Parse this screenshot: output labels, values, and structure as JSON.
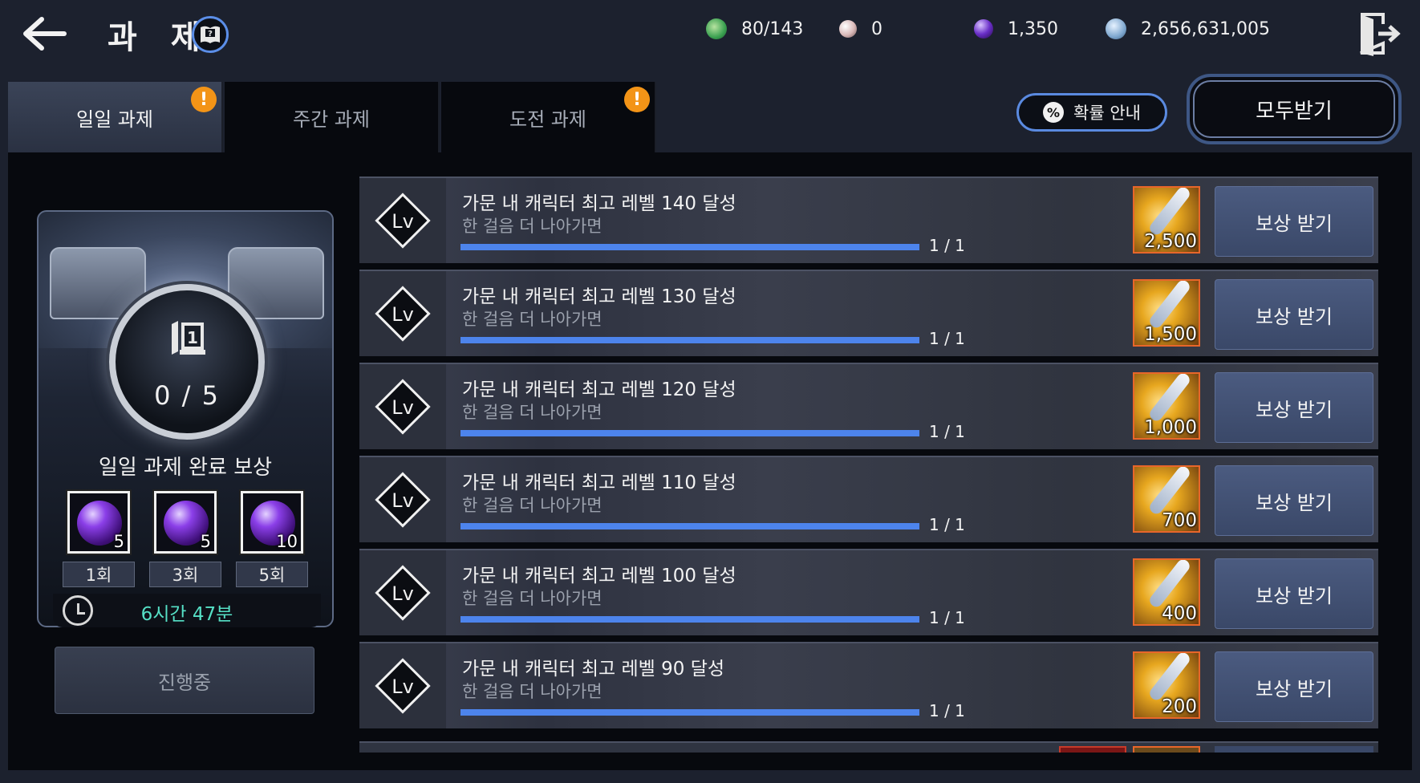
{
  "header": {
    "title": "과 제",
    "currencies": [
      {
        "icon": "stamina-icon",
        "value": "80/143",
        "color": "#3aa050"
      },
      {
        "icon": "pearl-icon",
        "value": "0",
        "color": "#d9b8b8"
      },
      {
        "icon": "purple-gem-icon",
        "value": "1,350",
        "color": "#6a2fc8"
      },
      {
        "icon": "silver-coin-icon",
        "value": "2,656,631,005",
        "color": "#7ea7cf"
      }
    ]
  },
  "tabs": [
    {
      "label": "일일 과제",
      "active": true,
      "alert": true
    },
    {
      "label": "주간 과제",
      "active": false,
      "alert": false
    },
    {
      "label": "도전 과제",
      "active": false,
      "alert": true
    }
  ],
  "alert_mark": "!",
  "probability_button": {
    "icon_text": "%",
    "label": "확률 안내"
  },
  "claim_all_label": "모두받기",
  "daily_card": {
    "medal_number": "1",
    "progress": "0 / 5",
    "title": "일일 과제 완료 보상",
    "rewards": [
      {
        "count": "5",
        "label": "1회"
      },
      {
        "count": "5",
        "label": "3회"
      },
      {
        "count": "10",
        "label": "5회"
      }
    ],
    "timer": "6시간 47분",
    "status_button": "진행중"
  },
  "quests": [
    {
      "title": "가문 내 캐릭터 최고 레벨 140 달성",
      "subtitle": "한 걸음 더 나아가면",
      "progress": "1 / 1",
      "progress_fraction": 1.0,
      "reward_amount": "2,500",
      "claim_label": "보상 받기"
    },
    {
      "title": "가문 내 캐릭터 최고 레벨 130 달성",
      "subtitle": "한 걸음 더 나아가면",
      "progress": "1 / 1",
      "progress_fraction": 1.0,
      "reward_amount": "1,500",
      "claim_label": "보상 받기"
    },
    {
      "title": "가문 내 캐릭터 최고 레벨 120 달성",
      "subtitle": "한 걸음 더 나아가면",
      "progress": "1 / 1",
      "progress_fraction": 1.0,
      "reward_amount": "1,000",
      "claim_label": "보상 받기"
    },
    {
      "title": "가문 내 캐릭터 최고 레벨 110 달성",
      "subtitle": "한 걸음 더 나아가면",
      "progress": "1 / 1",
      "progress_fraction": 1.0,
      "reward_amount": "700",
      "claim_label": "보상 받기"
    },
    {
      "title": "가문 내 캐릭터 최고 레벨 100 달성",
      "subtitle": "한 걸음 더 나아가면",
      "progress": "1 / 1",
      "progress_fraction": 1.0,
      "reward_amount": "400",
      "claim_label": "보상 받기"
    },
    {
      "title": "가문 내 캐릭터 최고 레벨 90 달성",
      "subtitle": "한 걸음 더 나아가면",
      "progress": "1 / 1",
      "progress_fraction": 1.0,
      "reward_amount": "200",
      "claim_label": "보상 받기"
    }
  ],
  "level_icon_text": "Lv",
  "colors": {
    "accent_blue": "#4d84ec",
    "alert_orange": "#f39417",
    "timer_teal": "#56e0c6"
  }
}
